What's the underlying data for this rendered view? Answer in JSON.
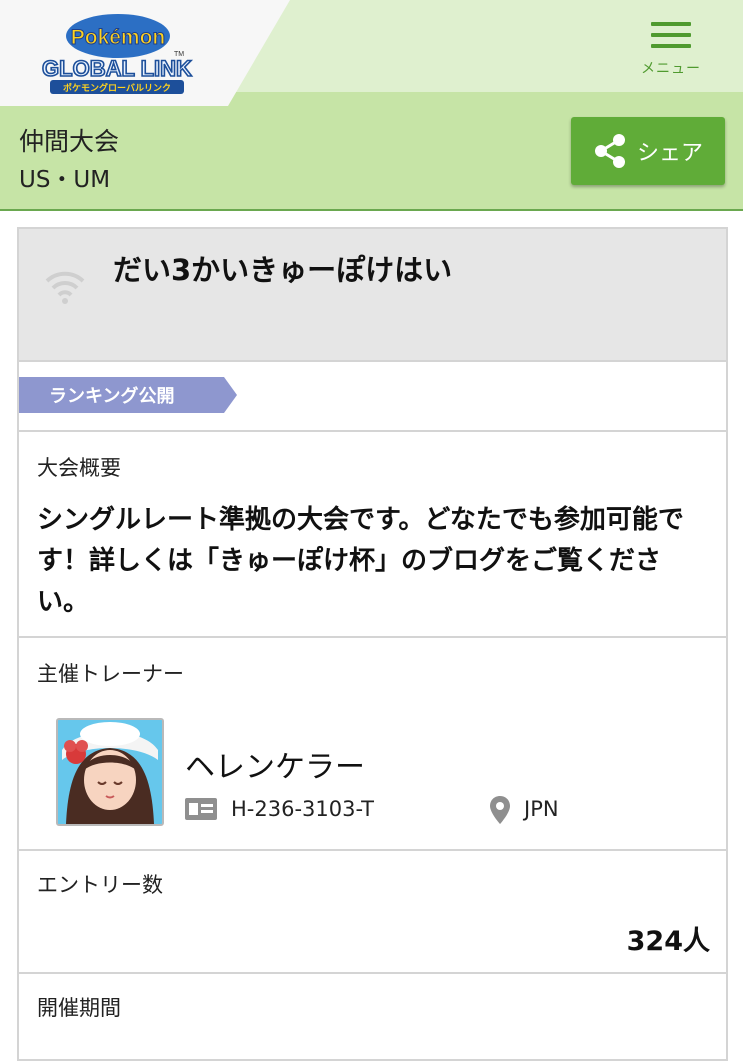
{
  "header": {
    "logo": {
      "brand_top": "Pokémon",
      "brand_main": "GLOBAL LINK",
      "brand_sub": "ポケモングローバルリンク",
      "trademark": "TM"
    },
    "menu_label": "メニュー"
  },
  "band": {
    "title": "仲間大会",
    "subtitle": "US・UM",
    "share_label": "シェア"
  },
  "competition": {
    "title": "だい3かいきゅーぽけはい",
    "status_badge": "ランキング公開",
    "overview_label": "大会概要",
    "overview_text": "シングルレート準拠の大会です。どなたでも参加可能です！詳しくは「きゅーぽけ杯」のブログをご覧ください。",
    "organizer_label": "主催トレーナー",
    "trainer": {
      "name": "ヘレンケラー",
      "id": "H-236-3103-T",
      "country": "JPN"
    },
    "entries_label": "エントリー数",
    "entries_value": "324人",
    "period_label": "開催期間"
  },
  "colors": {
    "header_bg": "#dff0cf",
    "band_bg": "#c6e4a6",
    "accent_green": "#60ac38",
    "status_badge": "#8e97cf",
    "card_head_bg": "#e6e6e6"
  },
  "icons": [
    "menu-icon",
    "share-icon",
    "wifi-icon",
    "id-card-icon",
    "location-pin-icon"
  ]
}
